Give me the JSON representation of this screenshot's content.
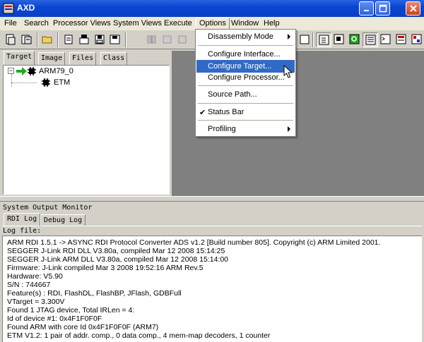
{
  "window": {
    "title": "AXD"
  },
  "menubar": {
    "items": [
      {
        "label": "File"
      },
      {
        "label": "Search"
      },
      {
        "label": "Processor Views"
      },
      {
        "label": "System Views"
      },
      {
        "label": "Execute"
      },
      {
        "label": "Options"
      },
      {
        "label": "Window"
      },
      {
        "label": "Help"
      }
    ]
  },
  "options_menu": {
    "items": [
      {
        "label": "Disassembly Mode",
        "submenu": true
      },
      {
        "label": "Configure Interface..."
      },
      {
        "label": "Configure Target...",
        "highlighted": true
      },
      {
        "label": "Configure Processor..."
      },
      {
        "label": "Source Path..."
      },
      {
        "label": "Status Bar",
        "checked": true
      },
      {
        "label": "Profiling",
        "submenu": true
      }
    ]
  },
  "left_tabs": [
    {
      "label": "Target",
      "active": true
    },
    {
      "label": "Image"
    },
    {
      "label": "Files"
    },
    {
      "label": "Class"
    }
  ],
  "tree": {
    "root": {
      "label": "ARM79_0",
      "expander": "⊟"
    },
    "child": {
      "label": "ETM"
    }
  },
  "monitor": {
    "title": "System Output Monitor",
    "tabs": [
      {
        "label": "RDI Log",
        "active": true
      },
      {
        "label": "Debug Log"
      }
    ],
    "logfile_label": "Log file:",
    "lines": [
      "ARM RDI 1.5.1 -> ASYNC RDI Protocol Converter ADS v1.2 [Build number 805]. Copyright (c) ARM Limited 2001.",
      "SEGGER J-Link RDI DLL V3.80a, compiled Mar 12 2008 15:14:25",
      "SEGGER J-Link ARM DLL V3.80a, compiled Mar 12 2008 15:14:00",
      "Firmware: J-Link compiled Mar  3 2008 19:52:16 ARM Rev.5",
      "Hardware: V5.90",
      "S/N : 744667",
      "Feature(s) : RDI, FlashDL, FlashBP, JFlash, GDBFull",
      "VTarget = 3.300V",
      "Found 1 JTAG device, Total IRLen = 4:",
      " Id of device #1: 0x4F1F0F0F",
      "Found ARM with core Id 0x4F1F0F0F (ARM7)",
      "ETM V1.2: 1 pair of addr. comp., 0 data comp., 4 mem-map decoders, 1 counter"
    ]
  },
  "colors": {
    "titlebar": "#0a46d4",
    "highlight": "#316ac5",
    "workspace": "#808080",
    "arrow": "#22aa22"
  }
}
